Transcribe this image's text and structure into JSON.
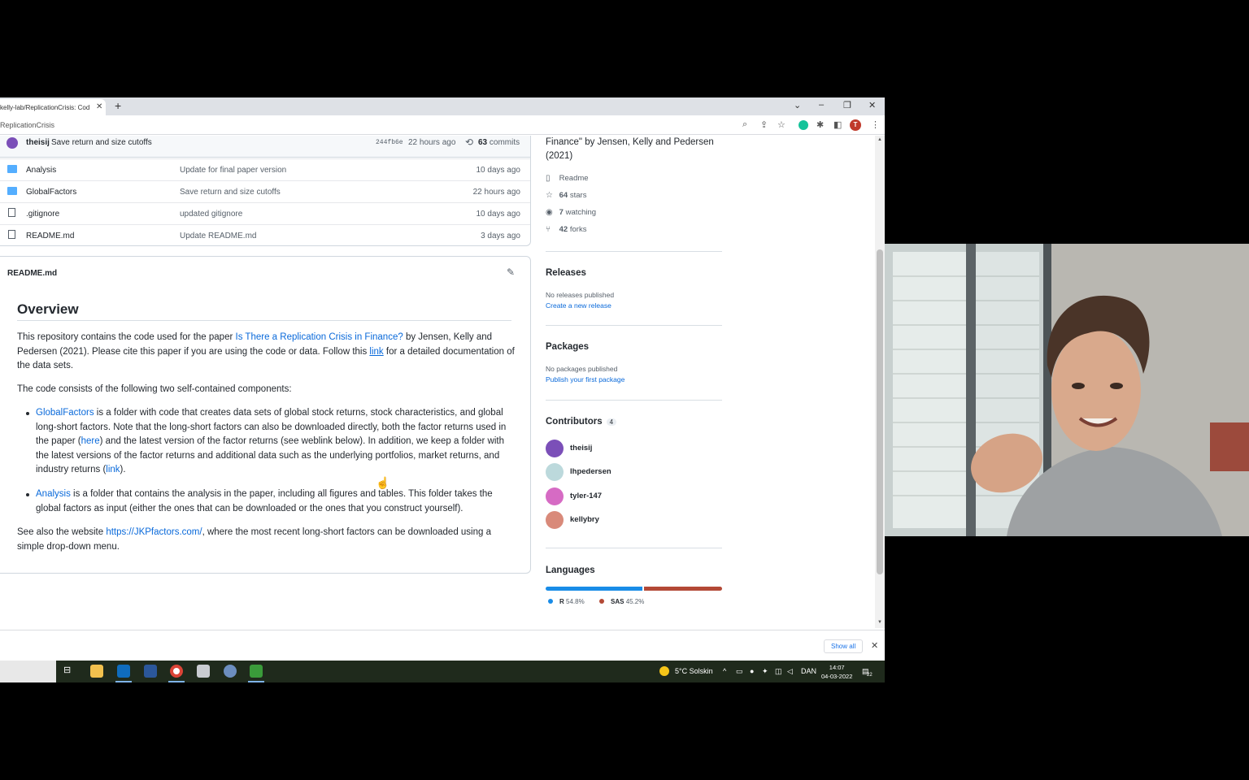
{
  "browser": {
    "tab_title": "kelly-lab/ReplicationCrisis: Cod",
    "url": "ReplicationCrisis"
  },
  "repo": {
    "latest_commit": {
      "author": "theisij",
      "message": "Save return and size cutoffs",
      "sha": "244fb6e",
      "time": "22 hours ago",
      "commits_count": "63",
      "commits_label": "commits"
    },
    "files": [
      {
        "name": "Analysis",
        "type": "folder",
        "commit": "Update for final paper version",
        "time": "10 days ago"
      },
      {
        "name": "GlobalFactors",
        "type": "folder",
        "commit": "Save return and size cutoffs",
        "time": "22 hours ago"
      },
      {
        "name": ".gitignore",
        "type": "file",
        "commit": "updated gitignore",
        "time": "10 days ago"
      },
      {
        "name": "README.md",
        "type": "file",
        "commit": "Update README.md",
        "time": "3 days ago"
      }
    ]
  },
  "readme": {
    "filename": "README.md",
    "heading": "Overview",
    "p1_a": "This repository contains the code used for the paper ",
    "p1_link": "Is There a Replication Crisis in Finance?",
    "p1_b": " by Jensen, Kelly and Pedersen (2021). Please cite this paper if you are using the code or data. Follow this ",
    "p1_link2": "link",
    "p1_c": " for a detailed documentation of the data sets.",
    "p2": "The code consists of the following two self-contained components:",
    "li1_link": "GlobalFactors",
    "li1_a": " is a folder with code that creates data sets of global stock returns, stock characteristics, and global long-short factors. Note that the long-short factors can also be downloaded directly, both the factor returns used in the paper (",
    "li1_here": "here",
    "li1_b": ") and the latest version of the factor returns (see weblink below). In addition, we keep a folder with the latest versions of the factor returns and additional data such as the underlying portfolios, market returns, and industry returns (",
    "li1_link2": "link",
    "li1_c": ").",
    "li2_link": "Analysis",
    "li2_a": " is a folder that contains the analysis in the paper, including all figures and tables. This folder takes the global factors as input (either the ones that can be downloaded or the ones that you construct yourself).",
    "p3_a": "See also the website ",
    "p3_link": "https://JKPfactors.com/",
    "p3_b": ", where the most recent long-short factors can be downloaded using a simple drop-down menu."
  },
  "sidebar": {
    "about_text": "Finance\" by Jensen, Kelly and Pedersen (2021)",
    "readme_label": "Readme",
    "stars_count": "64",
    "stars_label": "stars",
    "watching_count": "7",
    "watching_label": "watching",
    "forks_count": "42",
    "forks_label": "forks",
    "releases_heading": "Releases",
    "releases_none": "No releases published",
    "releases_create": "Create a new release",
    "packages_heading": "Packages",
    "packages_none": "No packages published",
    "packages_publish": "Publish your first package",
    "contributors_heading": "Contributors",
    "contributors_count": "4",
    "contributors": [
      {
        "name": "theisij",
        "color": "#7b4fb8"
      },
      {
        "name": "lhpedersen",
        "color": "#bcd9dc"
      },
      {
        "name": "tyler-147",
        "color": "#d66bc4"
      },
      {
        "name": "kellybry",
        "color": "#d98a7a"
      }
    ],
    "languages_heading": "Languages",
    "languages": [
      {
        "name": "R",
        "percent": "54.8%",
        "share": 54.8,
        "color": "#198ce7"
      },
      {
        "name": "SAS",
        "percent": "45.2%",
        "share": 45.2,
        "color": "#b34936"
      }
    ]
  },
  "download_bar": {
    "show_all": "Show all"
  },
  "taskbar": {
    "weather": "5°C  Solskin",
    "lang": "DAN",
    "time": "14:07",
    "date": "04-03-2022",
    "notif": "22"
  }
}
